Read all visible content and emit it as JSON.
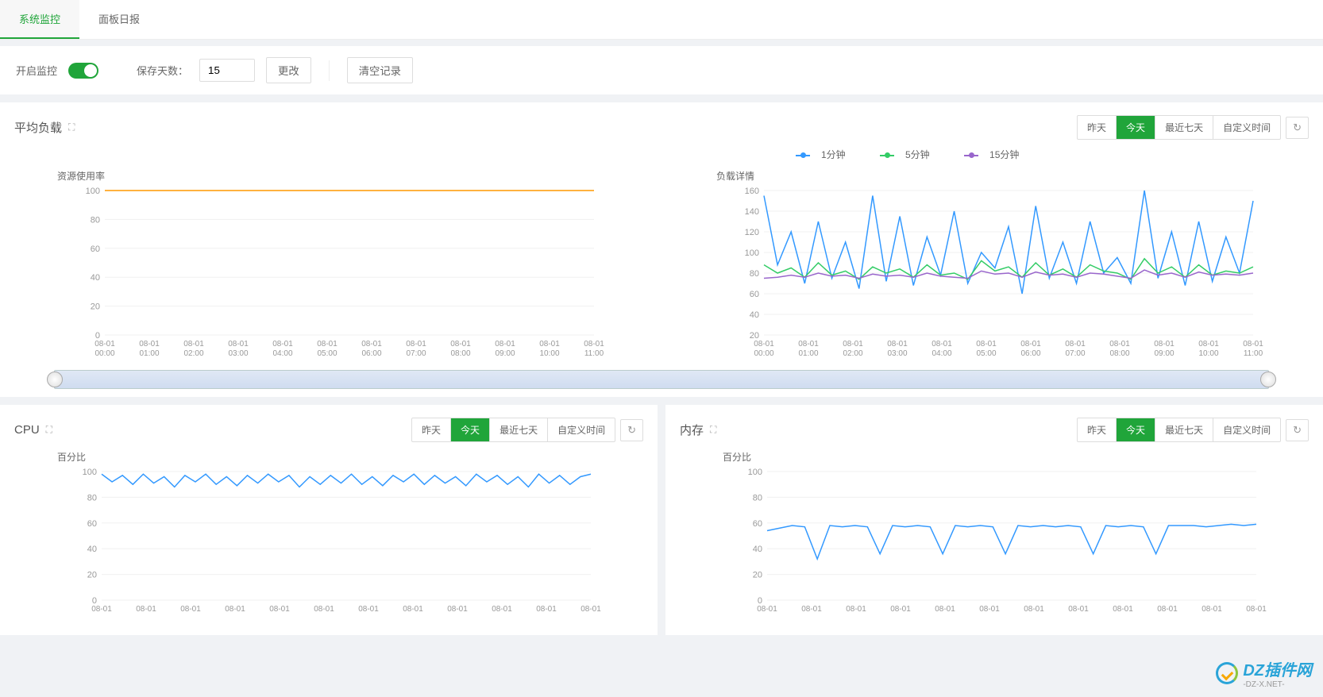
{
  "tabs": {
    "monitor": "系统监控",
    "report": "面板日报"
  },
  "toolbar": {
    "enable_label": "开启监控",
    "days_label": "保存天数：",
    "days_value": "15",
    "change_btn": "更改",
    "clear_btn": "清空记录"
  },
  "range": {
    "yesterday": "昨天",
    "today": "今天",
    "week": "最近七天",
    "custom": "自定义时间"
  },
  "refresh": "↻",
  "panels": {
    "load": {
      "title": "平均负载",
      "sub1": "资源使用率",
      "sub2": "负载详情"
    },
    "cpu": {
      "title": "CPU",
      "sub": "百分比"
    },
    "mem": {
      "title": "内存",
      "sub": "百分比"
    }
  },
  "legend": {
    "m1": "1分钟",
    "m5": "5分钟",
    "m15": "15分钟"
  },
  "colors": {
    "blue": "#3399ff",
    "green": "#33cc66",
    "purple": "#9966cc",
    "orange": "#ff9900"
  },
  "watermark": {
    "text": "DZ插件网",
    "sub": "-DZ-X.NET-"
  },
  "chart_data": [
    {
      "id": "resource_usage",
      "type": "line",
      "title": "资源使用率",
      "xlabel": "",
      "ylabel": "",
      "ylim": [
        0,
        100
      ],
      "yticks": [
        0,
        20,
        40,
        60,
        80,
        100
      ],
      "x_categories": [
        "08-01 00:00",
        "08-01 01:00",
        "08-01 02:00",
        "08-01 03:00",
        "08-01 04:00",
        "08-01 05:00",
        "08-01 06:00",
        "08-01 07:00",
        "08-01 08:00",
        "08-01 09:00",
        "08-01 10:00",
        "08-01 11:00"
      ],
      "series": [
        {
          "name": "资源使用率",
          "color": "#ff9900",
          "values": [
            100,
            100,
            100,
            100,
            100,
            100,
            100,
            100,
            100,
            100,
            100,
            100
          ]
        }
      ]
    },
    {
      "id": "load_detail",
      "type": "line",
      "title": "负载详情",
      "xlabel": "",
      "ylabel": "",
      "ylim": [
        20,
        160
      ],
      "yticks": [
        20,
        40,
        60,
        80,
        100,
        120,
        140,
        160
      ],
      "x_categories": [
        "08-01 00:00",
        "08-01 01:00",
        "08-01 02:00",
        "08-01 03:00",
        "08-01 04:00",
        "08-01 05:00",
        "08-01 06:00",
        "08-01 07:00",
        "08-01 08:00",
        "08-01 09:00",
        "08-01 10:00",
        "08-01 11:00"
      ],
      "series": [
        {
          "name": "1分钟",
          "color": "#3399ff",
          "values": [
            155,
            88,
            120,
            70,
            130,
            75,
            110,
            65,
            155,
            72,
            135,
            68,
            115,
            78,
            140,
            70,
            100,
            85,
            125,
            60,
            145,
            75,
            110,
            70,
            130,
            80,
            95,
            70,
            160,
            75,
            120,
            68,
            130,
            72,
            115,
            80,
            150
          ]
        },
        {
          "name": "5分钟",
          "color": "#33cc66",
          "values": [
            88,
            80,
            85,
            76,
            90,
            78,
            82,
            74,
            86,
            80,
            84,
            76,
            88,
            78,
            80,
            74,
            92,
            82,
            86,
            76,
            90,
            78,
            84,
            76,
            88,
            82,
            80,
            74,
            94,
            80,
            86,
            76,
            88,
            78,
            82,
            80,
            86
          ]
        },
        {
          "name": "15分钟",
          "color": "#9966cc",
          "values": [
            75,
            76,
            78,
            76,
            80,
            77,
            78,
            75,
            79,
            77,
            78,
            76,
            80,
            77,
            76,
            75,
            82,
            79,
            80,
            76,
            81,
            78,
            79,
            76,
            80,
            79,
            77,
            75,
            83,
            78,
            80,
            76,
            81,
            78,
            79,
            78,
            80
          ]
        }
      ]
    },
    {
      "id": "cpu",
      "type": "line",
      "title": "百分比",
      "xlabel": "",
      "ylabel": "",
      "ylim": [
        0,
        100
      ],
      "yticks": [
        0,
        20,
        40,
        60,
        80,
        100
      ],
      "x_categories": [
        "08-01",
        "08-01",
        "08-01",
        "08-01",
        "08-01",
        "08-01",
        "08-01",
        "08-01",
        "08-01",
        "08-01",
        "08-01",
        "08-01"
      ],
      "series": [
        {
          "name": "CPU",
          "color": "#3399ff",
          "values": [
            98,
            92,
            97,
            90,
            98,
            91,
            96,
            88,
            97,
            92,
            98,
            90,
            96,
            89,
            97,
            91,
            98,
            92,
            97,
            88,
            96,
            90,
            97,
            91,
            98,
            90,
            96,
            89,
            97,
            92,
            98,
            90,
            97,
            91,
            96,
            89,
            98,
            92,
            97,
            90,
            96,
            88,
            98,
            91,
            97,
            90,
            96,
            98
          ]
        }
      ]
    },
    {
      "id": "memory",
      "type": "line",
      "title": "百分比",
      "xlabel": "",
      "ylabel": "",
      "ylim": [
        0,
        100
      ],
      "yticks": [
        0,
        20,
        40,
        60,
        80,
        100
      ],
      "x_categories": [
        "08-01",
        "08-01",
        "08-01",
        "08-01",
        "08-01",
        "08-01",
        "08-01",
        "08-01",
        "08-01",
        "08-01",
        "08-01",
        "08-01"
      ],
      "series": [
        {
          "name": "内存",
          "color": "#3399ff",
          "values": [
            54,
            56,
            58,
            57,
            32,
            58,
            57,
            58,
            57,
            36,
            58,
            57,
            58,
            57,
            36,
            58,
            57,
            58,
            57,
            36,
            58,
            57,
            58,
            57,
            58,
            57,
            36,
            58,
            57,
            58,
            57,
            36,
            58,
            58,
            58,
            57,
            58,
            59,
            58,
            59
          ]
        }
      ]
    }
  ]
}
